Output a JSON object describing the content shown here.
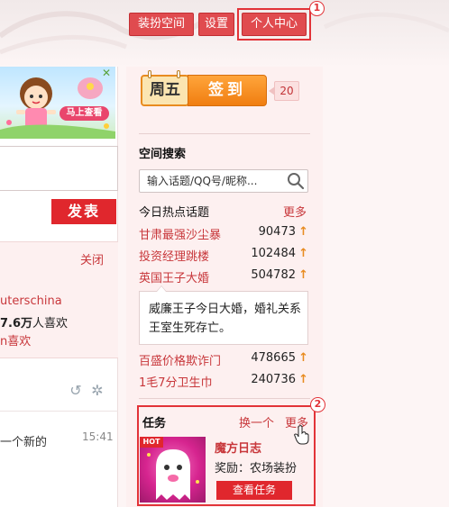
{
  "header": {
    "buttons": {
      "dress": "装扮空间",
      "settings": "设置",
      "personal_center": "个人中心"
    },
    "annotation_1": "1"
  },
  "left": {
    "banner": {
      "button_label": "马上查看",
      "close_symbol": "✕"
    },
    "post_button": "发表",
    "feed_card": {
      "close": "关闭",
      "user_fragment": "uterschina",
      "likes_num": "7.6万",
      "likes_suffix": "人喜欢",
      "like_link": "n喜欢"
    },
    "feed_item": {
      "text": "一个新的",
      "time": "15:41"
    }
  },
  "right": {
    "checkin": {
      "day": "周五",
      "button": "签到",
      "count": "20"
    },
    "search": {
      "title": "空间搜索",
      "placeholder": "输入话题/QQ号/昵称..."
    },
    "hot": {
      "title": "今日热点话题",
      "more": "更多",
      "rows_top": [
        {
          "name": "甘肃最强沙尘暴",
          "count": "90473"
        },
        {
          "name": "投资经理跳楼",
          "count": "102484"
        },
        {
          "name": "英国王子大婚",
          "count": "504782"
        }
      ],
      "popup": "威廉王子今日大婚，婚礼关系王室生死存亡。",
      "rows_bottom": [
        {
          "name": "百盛价格欺诈门",
          "count": "478665"
        },
        {
          "name": "1毛7分卫生巾",
          "count": "240736"
        }
      ],
      "arrow": "↑"
    },
    "task": {
      "title": "任务",
      "swap": "换一个",
      "more": "更多",
      "hot_badge": "HOT",
      "name": "魔方日志",
      "reward": "奖励：农场装扮",
      "button": "查看任务"
    },
    "annotation_2": "2"
  },
  "colors": {
    "accent_red": "#e0272d",
    "link_red": "#c8373b",
    "orange": "#f07d10",
    "panel_bg": "#fdf0f0"
  }
}
